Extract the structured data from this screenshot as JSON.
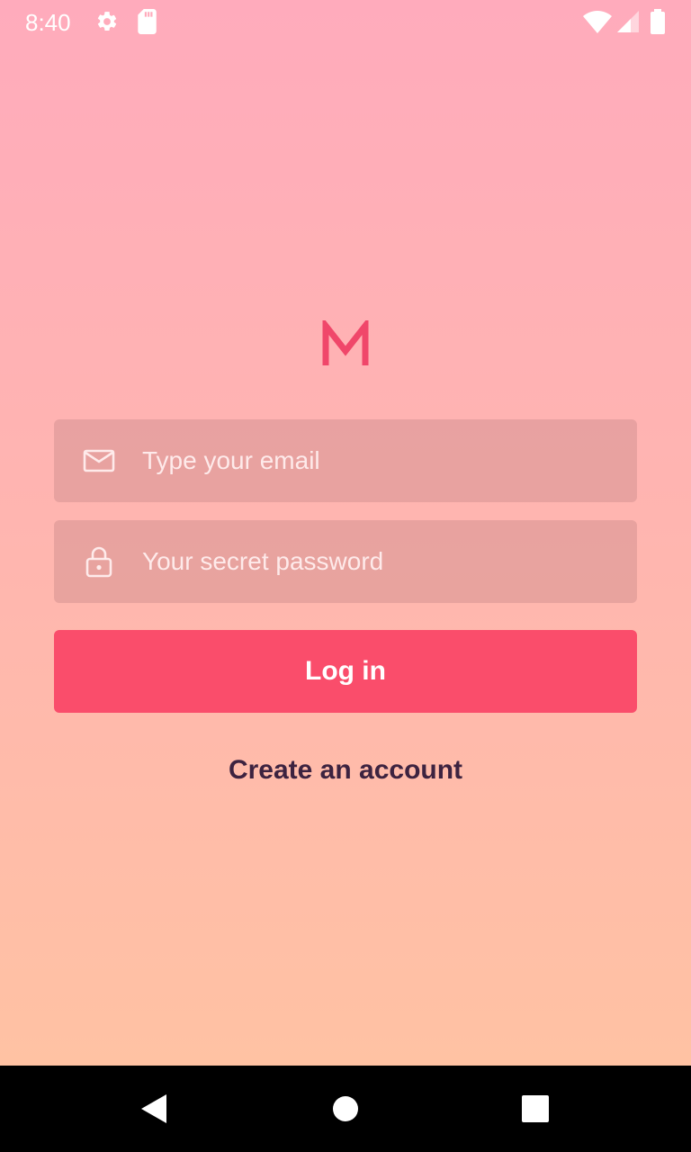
{
  "status_bar": {
    "time": "8:40",
    "icons": [
      "settings-icon",
      "sd-card-icon",
      "wifi-icon",
      "signal-icon",
      "battery-icon"
    ]
  },
  "logo": {
    "letter": "M",
    "color": "#f0476a"
  },
  "login_form": {
    "email": {
      "icon": "mail-icon",
      "placeholder": "Type your email",
      "value": ""
    },
    "password": {
      "icon": "lock-icon",
      "placeholder": "Your secret password",
      "value": ""
    },
    "submit_label": "Log in",
    "create_account_label": "Create an account"
  },
  "colors": {
    "gradient_top": "#ffabbc",
    "gradient_bottom": "#ffc4a1",
    "button": "#fa4d6b",
    "link_text": "#3d2340"
  },
  "nav_bar": {
    "buttons": [
      "back-icon",
      "home-icon",
      "recents-icon"
    ]
  }
}
